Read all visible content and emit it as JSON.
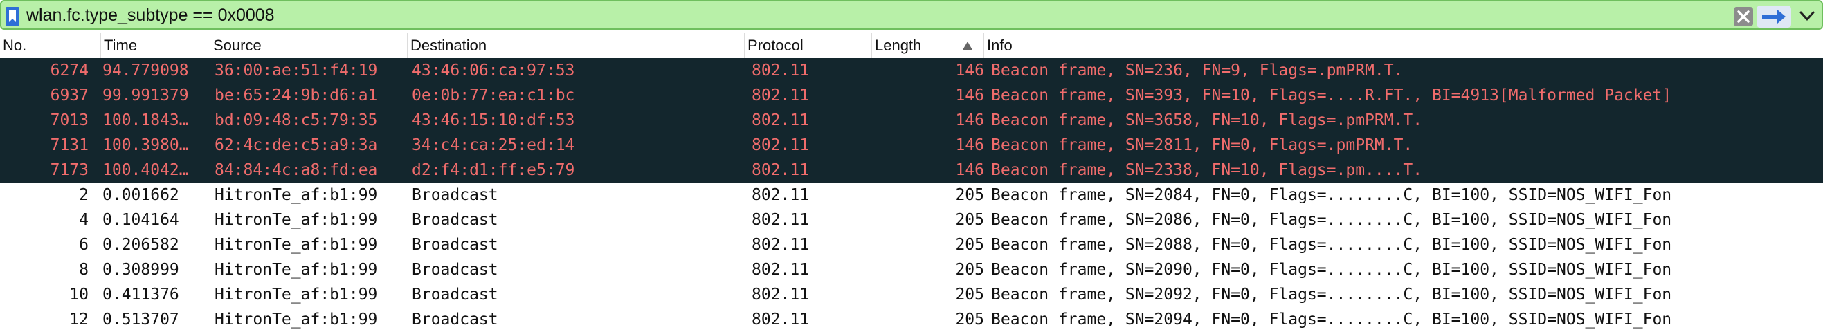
{
  "filter": {
    "value": "wlan.fc.type_subtype == 0x0008"
  },
  "columns": [
    "No.",
    "Time",
    "Source",
    "Destination",
    "Protocol",
    "Length",
    "Info"
  ],
  "packets": [
    {
      "no": "6274",
      "time": "94.779098",
      "source": "36:00:ae:51:f4:19",
      "destination": "43:46:06:ca:97:53",
      "protocol": "802.11",
      "length": "146",
      "info": "Beacon frame, SN=236, FN=9, Flags=.pmPRM.T.",
      "style": "dark"
    },
    {
      "no": "6937",
      "time": "99.991379",
      "source": "be:65:24:9b:d6:a1",
      "destination": "0e:0b:77:ea:c1:bc",
      "protocol": "802.11",
      "length": "146",
      "info": "Beacon frame, SN=393, FN=10, Flags=....R.FT., BI=4913[Malformed Packet]",
      "style": "dark"
    },
    {
      "no": "7013",
      "time": "100.1843…",
      "source": "bd:09:48:c5:79:35",
      "destination": "43:46:15:10:df:53",
      "protocol": "802.11",
      "length": "146",
      "info": "Beacon frame, SN=3658, FN=10, Flags=.pmPRM.T.",
      "style": "dark"
    },
    {
      "no": "7131",
      "time": "100.3980…",
      "source": "62:4c:de:c5:a9:3a",
      "destination": "34:c4:ca:25:ed:14",
      "protocol": "802.11",
      "length": "146",
      "info": "Beacon frame, SN=2811, FN=0, Flags=.pmPRM.T.",
      "style": "dark"
    },
    {
      "no": "7173",
      "time": "100.4042…",
      "source": "84:84:4c:a8:fd:ea",
      "destination": "d2:f4:d1:ff:e5:79",
      "protocol": "802.11",
      "length": "146",
      "info": "Beacon frame, SN=2338, FN=10, Flags=.pm....T.",
      "style": "dark"
    },
    {
      "no": "2",
      "time": "0.001662",
      "source": "HitronTe_af:b1:99",
      "destination": "Broadcast",
      "protocol": "802.11",
      "length": "205",
      "info": "Beacon frame, SN=2084, FN=0, Flags=........C, BI=100, SSID=NOS_WIFI_Fon",
      "style": "light"
    },
    {
      "no": "4",
      "time": "0.104164",
      "source": "HitronTe_af:b1:99",
      "destination": "Broadcast",
      "protocol": "802.11",
      "length": "205",
      "info": "Beacon frame, SN=2086, FN=0, Flags=........C, BI=100, SSID=NOS_WIFI_Fon",
      "style": "light"
    },
    {
      "no": "6",
      "time": "0.206582",
      "source": "HitronTe_af:b1:99",
      "destination": "Broadcast",
      "protocol": "802.11",
      "length": "205",
      "info": "Beacon frame, SN=2088, FN=0, Flags=........C, BI=100, SSID=NOS_WIFI_Fon",
      "style": "light"
    },
    {
      "no": "8",
      "time": "0.308999",
      "source": "HitronTe_af:b1:99",
      "destination": "Broadcast",
      "protocol": "802.11",
      "length": "205",
      "info": "Beacon frame, SN=2090, FN=0, Flags=........C, BI=100, SSID=NOS_WIFI_Fon",
      "style": "light"
    },
    {
      "no": "10",
      "time": "0.411376",
      "source": "HitronTe_af:b1:99",
      "destination": "Broadcast",
      "protocol": "802.11",
      "length": "205",
      "info": "Beacon frame, SN=2092, FN=0, Flags=........C, BI=100, SSID=NOS_WIFI_Fon",
      "style": "light"
    },
    {
      "no": "12",
      "time": "0.513707",
      "source": "HitronTe_af:b1:99",
      "destination": "Broadcast",
      "protocol": "802.11",
      "length": "205",
      "info": "Beacon frame, SN=2094, FN=0, Flags=........C, BI=100, SSID=NOS_WIFI_Fon",
      "style": "light"
    }
  ],
  "icons": {
    "bookmark": "bookmark-icon",
    "clear": "clear-icon",
    "apply": "arrow-right-icon",
    "history": "chevron-down-icon",
    "sort": "sort-ascending-icon"
  },
  "colors": {
    "filter_valid_bg": "#b8f0a8",
    "marked_row_bg": "#13262d",
    "marked_row_text": "#f06c6c"
  }
}
